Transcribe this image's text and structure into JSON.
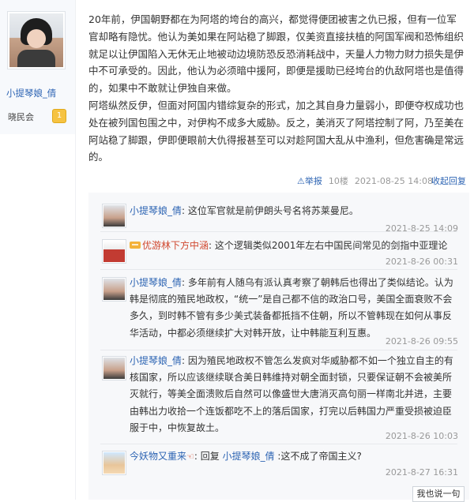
{
  "author": {
    "name": "小提琴娘_倩",
    "grade_label": "晓民会",
    "grade_level": "1"
  },
  "post": {
    "paragraphs": [
      "20年前，伊国朝野都在为阿塔的垮台的高兴，都觉得便团被害之仇已报，但有一位军官却略有隐忧。他认为美如果在阿站稳了脚跟，仅美资直接扶植的阿国军阀和恐怖组织就足以让伊国陷入无休无止地被动边境防恐反恐消耗战中，天量人力物力财力损失是伊中不可承受的。因此，他认为必须暗中援阿，即便是援助已经垮台的仇敌阿塔也是值得的，如果中不敢就让伊独自来做。",
      "阿塔纵然反伊，但面对阿国内错综复杂的形式，加之其自身力量弱小，即便夺权成功也处在被列国包围之中，对伊构不成多大威胁。反之，美消灭了阿塔控制了阿，乃至美在阿站稳了脚跟，伊即便眼前大仇得报甚至可以对趁阿国大乱从中渔利，但危害确是常远的。"
    ],
    "report_label": "举报",
    "floor": "10楼",
    "timestamp": "2021-08-25 14:08",
    "collapse_reply_label": "收起回复"
  },
  "replies": [
    {
      "name": "小提琴娘_倩",
      "text": ": 这位军官就是前伊朗头号名将苏莱曼尼。",
      "time": "2021-8-25 14:09"
    },
    {
      "name": "优游林下方中涵",
      "text": ": 这个逻辑类似2001年左右中国民间常见的剑指中亚理论",
      "time": "2021-8-26 00:31"
    },
    {
      "name": "小提琴娘_倩",
      "text": ": 多年前有人随乌有派认真考察了朝韩后也得出了类似结论。认为韩是彻底的殖民地政权，“统一”是自己都不信的政治口号，美国全面衰败不会多久，到时韩不管有多少美式装备都抵挡不住朝，所以不管韩现在如何从事反华活动，中都必须继续扩大对韩开放，让中韩能互利互惠。",
      "time": "2021-8-26 09:55"
    },
    {
      "name": "小提琴娘_倩",
      "text": ": 因为殖民地政权不管怎么发疯对华威胁都不如一个独立自主的有核国家，所以应该继续联合美日韩维持对朝全面封锁，只要保证朝不会被美所灭就行，等美全面溃败后自然可以像盛世大唐消灭高句丽一样南北并进，主要由韩出力收拾一个连饭都吃不上的落后国家，打完以后韩国力严重受损被迫臣服于中，中恢复故土。",
      "time": "2021-8-26 10:03"
    },
    {
      "name": "今妖物又重来",
      "reply_prefix": ": 回复",
      "reply_target": "小提琴娘_倩",
      "text": " :这不成了帝国主义?",
      "time": "2021-8-27 16:31"
    }
  ],
  "say_button_label": "我也说一句",
  "colors": {
    "link": "#2d64b3",
    "accent": "#d0482f",
    "reply_bg": "#f7f8fa"
  }
}
